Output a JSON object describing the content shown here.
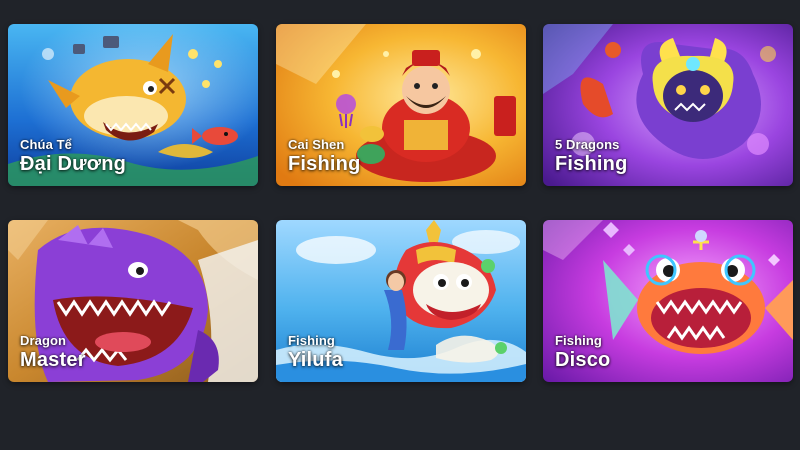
{
  "games": [
    {
      "subtitle": "Chúa Tể",
      "title": "Đại Dương",
      "theme": "shark-ocean",
      "color": "#1f6fd6"
    },
    {
      "subtitle": "Cai Shen",
      "title": "Fishing",
      "theme": "god-of-wealth",
      "color": "#f29a1a"
    },
    {
      "subtitle": "5 Dragons",
      "title": "Fishing",
      "theme": "dragon",
      "color": "#8a2fd0"
    },
    {
      "subtitle": "Dragon",
      "title": "Master",
      "theme": "purple-dinosaur",
      "color": "#c9872e"
    },
    {
      "subtitle": "Fishing",
      "title": "Yilufa",
      "theme": "lion-dance",
      "color": "#3fa6e6"
    },
    {
      "subtitle": "Fishing",
      "title": "Disco",
      "theme": "disco-fish",
      "color": "#c73ce0"
    }
  ]
}
